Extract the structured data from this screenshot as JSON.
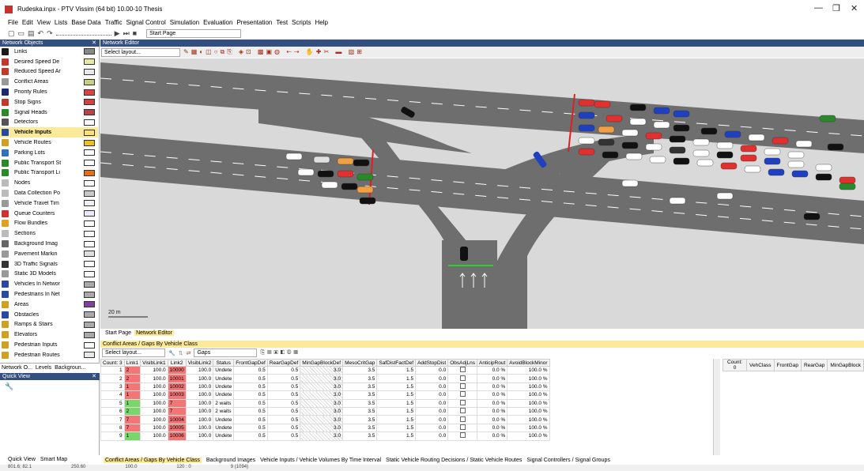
{
  "window": {
    "title": "Rudeska.inpx - PTV Vissim (64 bit) 10.00-10 Thesis"
  },
  "window_controls": {
    "minimize": "—",
    "restore": "❐",
    "close": "✕"
  },
  "menu": [
    "File",
    "Edit",
    "View",
    "Lists",
    "Base Data",
    "Traffic",
    "Signal Control",
    "Simulation",
    "Evaluation",
    "Presentation",
    "Test",
    "Scripts",
    "Help"
  ],
  "toolbar": {
    "start_page": "Start Page"
  },
  "network_objects": {
    "title": "Network Objects",
    "items": [
      {
        "label": "Links",
        "color": "#1a1a1a",
        "swatch": "#888888"
      },
      {
        "label": "Desired Speed De",
        "color": "#c0392b",
        "swatch": "#e8e8a0"
      },
      {
        "label": "Reduced Speed Ar",
        "color": "#c0392b",
        "swatch": "#e8e8e8"
      },
      {
        "label": "Conflict Areas",
        "color": "#999999",
        "swatch": "#c8d080"
      },
      {
        "label": "Priority Rules",
        "color": "#1a2a6e",
        "swatch": "#e04040"
      },
      {
        "label": "Stop Signs",
        "color": "#c0392b",
        "swatch": "#d04040"
      },
      {
        "label": "Signal Heads",
        "color": "#2a8a2a",
        "swatch": "#c04040"
      },
      {
        "label": "Detectors",
        "color": "#555555",
        "swatch": "#ffffff"
      },
      {
        "label": "Vehicle Inputs",
        "color": "#2a4aa0",
        "swatch": "#ffe070"
      },
      {
        "label": "Vehicle Routes",
        "color": "#d0a020",
        "swatch": "#f0c020"
      },
      {
        "label": "Parking Lots",
        "color": "#3070c0",
        "swatch": "#ffffff"
      },
      {
        "label": "Public Transport St",
        "color": "#2a8a2a",
        "swatch": "#ffffff"
      },
      {
        "label": "Public Transport Li",
        "color": "#2a8a2a",
        "swatch": "#e07020"
      },
      {
        "label": "Nodes",
        "color": "#bbbbbb",
        "swatch": "#ffffff"
      },
      {
        "label": "Data Collection Po",
        "color": "#bbbbbb",
        "swatch": "#c8c8c8"
      },
      {
        "label": "Vehicle Travel Tim",
        "color": "#999999",
        "swatch": "#f0f0f0"
      },
      {
        "label": "Queue Counters",
        "color": "#d03030",
        "swatch": "#e8e8ff"
      },
      {
        "label": "Flow Bundles",
        "color": "#e0a020",
        "swatch": "#ffffff"
      },
      {
        "label": "Sections",
        "color": "#bbbbbb",
        "swatch": "#ffffff"
      },
      {
        "label": "Background Imag",
        "color": "#666666",
        "swatch": "#ffffff"
      },
      {
        "label": "Pavement Markin",
        "color": "#999999",
        "swatch": "#dddddd"
      },
      {
        "label": "3D Traffic Signals",
        "color": "#333333",
        "swatch": "#ffffff"
      },
      {
        "label": "Static 3D Models",
        "color": "#999999",
        "swatch": "#ffffff"
      },
      {
        "label": "Vehicles In Networ",
        "color": "#2a4aa0",
        "swatch": "#aaaaaa"
      },
      {
        "label": "Pedestrians In Net",
        "color": "#2a4aa0",
        "swatch": "#aaaaaa"
      },
      {
        "label": "Areas",
        "color": "#d0a020",
        "swatch": "#8040a0"
      },
      {
        "label": "Obstacles",
        "color": "#2a4aa0",
        "swatch": "#aaaaaa"
      },
      {
        "label": "Ramps & Stairs",
        "color": "#d0a020",
        "swatch": "#aaaaaa"
      },
      {
        "label": "Elevators",
        "color": "#d0a020",
        "swatch": "#aaaaaa"
      },
      {
        "label": "Pedestrian Inputs",
        "color": "#d0a020",
        "swatch": "#ffffff"
      },
      {
        "label": "Pedestrian Routes",
        "color": "#d0a020",
        "swatch": "#e8e8e8"
      }
    ],
    "tabs": [
      "Network O...",
      "Levels",
      "Backgroun..."
    ]
  },
  "quick_view": {
    "title": "Quick View",
    "tabs": [
      "Quick View",
      "Smart Map"
    ]
  },
  "network_editor": {
    "title": "Network Editor",
    "layout_placeholder": "Select layout...",
    "scale": "20 m",
    "tabs": [
      "Start Page",
      "Network Editor"
    ]
  },
  "conflict_list": {
    "title": "Conflict Areas / Gaps By Vehicle Class",
    "layout": "Select layout...",
    "gaps": "Gaps",
    "count_label": "Count: 3",
    "columns": [
      "Count: 3",
      "Link1",
      "VisibLink1",
      "Link2",
      "VisibLink2",
      "Status",
      "FrontGapDef",
      "RearGapDef",
      "MinGapBlockDef",
      "MesoCritGap",
      "SafDistFactDef",
      "AddStopDist",
      "ObsAdjLns",
      "AnticipRout",
      "AvoidBlockMinor"
    ],
    "rows": [
      {
        "n": "1",
        "link1": "2",
        "v1": "100.0",
        "link2": "10000",
        "v2": "100.0",
        "status": "Undete",
        "fg": "0.5",
        "rg": "0.5",
        "mg": "3.0",
        "mc": "3.5",
        "sd": "1.5",
        "as": "0.0",
        "ar": "0.0 %",
        "ab": "100.0 %",
        "c1": "red",
        "c2": "red"
      },
      {
        "n": "2",
        "link1": "2",
        "v1": "100.0",
        "link2": "10001",
        "v2": "100.0",
        "status": "Undete",
        "fg": "0.5",
        "rg": "0.5",
        "mg": "3.0",
        "mc": "3.5",
        "sd": "1.5",
        "as": "0.0",
        "ar": "0.0 %",
        "ab": "100.0 %",
        "c1": "red",
        "c2": "red"
      },
      {
        "n": "3",
        "link1": "1",
        "v1": "100.0",
        "link2": "10002",
        "v2": "100.0",
        "status": "Undete",
        "fg": "0.5",
        "rg": "0.5",
        "mg": "3.0",
        "mc": "3.5",
        "sd": "1.5",
        "as": "0.0",
        "ar": "0.0 %",
        "ab": "100.0 %",
        "c1": "red",
        "c2": "red"
      },
      {
        "n": "4",
        "link1": "1",
        "v1": "100.0",
        "link2": "10003",
        "v2": "100.0",
        "status": "Undete",
        "fg": "0.5",
        "rg": "0.5",
        "mg": "3.0",
        "mc": "3.5",
        "sd": "1.5",
        "as": "0.0",
        "ar": "0.0 %",
        "ab": "100.0 %",
        "c1": "red",
        "c2": "red"
      },
      {
        "n": "5",
        "link1": "1",
        "v1": "100.0",
        "link2": "7",
        "v2": "100.0",
        "status": "2 waits",
        "fg": "0.5",
        "rg": "0.5",
        "mg": "3.0",
        "mc": "3.5",
        "sd": "1.5",
        "as": "0.0",
        "ar": "0.0 %",
        "ab": "100.0 %",
        "c1": "grn",
        "c2": "red"
      },
      {
        "n": "6",
        "link1": "2",
        "v1": "100.0",
        "link2": "7",
        "v2": "100.0",
        "status": "2 waits",
        "fg": "0.5",
        "rg": "0.5",
        "mg": "3.0",
        "mc": "3.5",
        "sd": "1.5",
        "as": "0.0",
        "ar": "0.0 %",
        "ab": "100.0 %",
        "c1": "grn",
        "c2": "red"
      },
      {
        "n": "7",
        "link1": "7",
        "v1": "100.0",
        "link2": "10004",
        "v2": "100.0",
        "status": "Undete",
        "fg": "0.5",
        "rg": "0.5",
        "mg": "3.0",
        "mc": "3.5",
        "sd": "1.5",
        "as": "0.0",
        "ar": "0.0 %",
        "ab": "100.0 %",
        "c1": "red",
        "c2": "red"
      },
      {
        "n": "8",
        "link1": "7",
        "v1": "100.0",
        "link2": "10005",
        "v2": "100.0",
        "status": "Undete",
        "fg": "0.5",
        "rg": "0.5",
        "mg": "3.0",
        "mc": "3.5",
        "sd": "1.5",
        "as": "0.0",
        "ar": "0.0 %",
        "ab": "100.0 %",
        "c1": "red",
        "c2": "red"
      },
      {
        "n": "9",
        "link1": "1",
        "v1": "100.0",
        "link2": "10006",
        "v2": "100.0",
        "status": "Undete",
        "fg": "0.5",
        "rg": "0.5",
        "mg": "3.0",
        "mc": "3.5",
        "sd": "1.5",
        "as": "0.0",
        "ar": "0.0 %",
        "ab": "100.0 %",
        "c1": "grn",
        "c2": "red"
      }
    ],
    "right_columns": [
      "Count: 0",
      "VehClass",
      "FrontGap",
      "RearGap",
      "MinGapBlock"
    ]
  },
  "bottom_tabs": [
    "Conflict Areas / Gaps By Vehicle Class",
    "Background Images",
    "Vehicle Inputs / Vehicle Volumes By Time Interval",
    "Static Vehicle Routing Decisions / Static Vehicle Routes",
    "Signal Controllers / Signal Groups"
  ],
  "status": [
    "801.6; 82.1",
    "250.60",
    "100.0",
    "120 : 0",
    "9 (1094)"
  ],
  "colors": {
    "panel_header": "#324f80",
    "selected": "#fde99a",
    "road": "#6e6e6e",
    "ground": "#d9d9d9"
  }
}
